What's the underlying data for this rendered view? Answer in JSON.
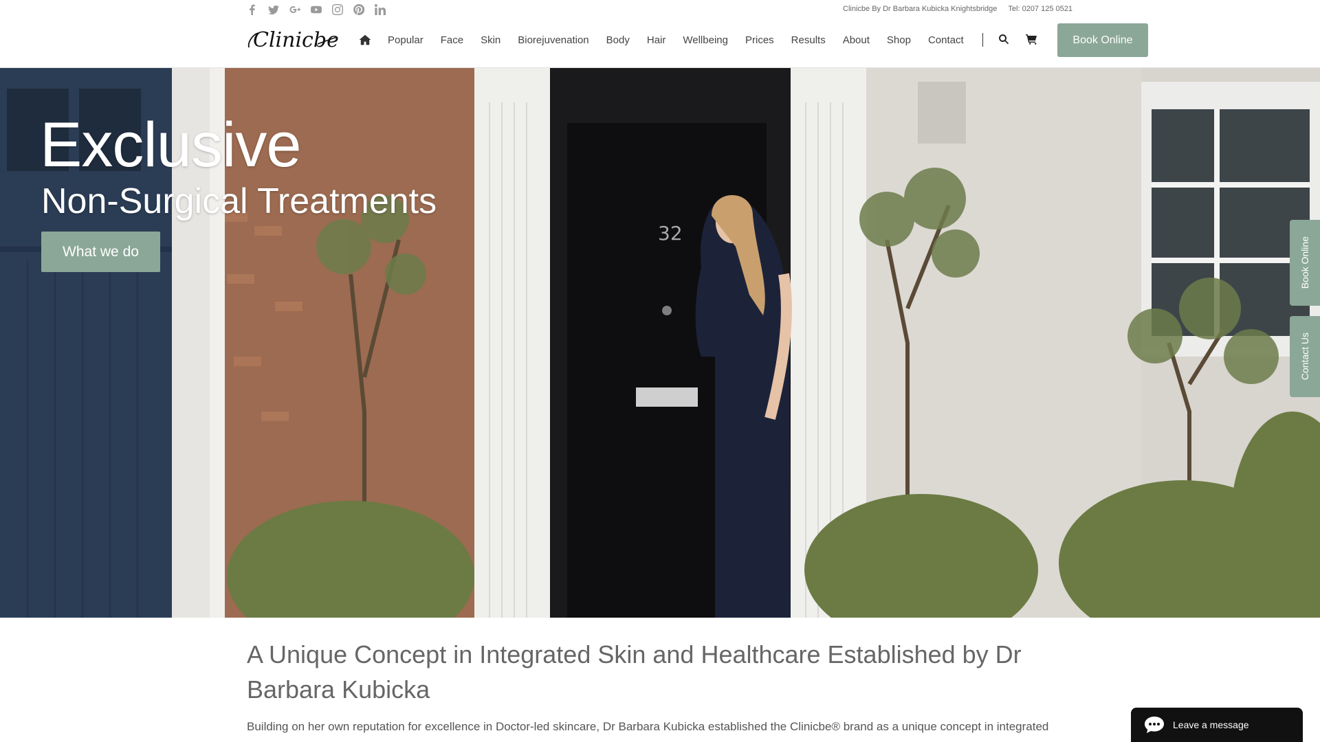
{
  "topbar": {
    "social": [
      {
        "icon": "facebook-icon"
      },
      {
        "icon": "twitter-icon"
      },
      {
        "icon": "google-plus-icon"
      },
      {
        "icon": "youtube-icon"
      },
      {
        "icon": "instagram-icon"
      },
      {
        "icon": "pinterest-icon"
      },
      {
        "icon": "linkedin-icon"
      }
    ],
    "clinic_name": "Clinicbe By Dr Barbara Kubicka Knightsbridge",
    "phone": "Tel: 0207 125 0521"
  },
  "header": {
    "logo_text": "Clinicbe",
    "nav": [
      "Popular",
      "Face",
      "Skin",
      "Biorejuvenation",
      "Body",
      "Hair",
      "Wellbeing",
      "Prices",
      "Results",
      "About",
      "Shop",
      "Contact"
    ],
    "book_label": "Book Online"
  },
  "hero": {
    "title": "Exclusive",
    "subtitle": "Non-Surgical Treatments",
    "button": "What we do",
    "door_number": "32"
  },
  "side_tabs": {
    "book": "Book Online",
    "contact": "Contact Us"
  },
  "content": {
    "heading": "A Unique Concept in Integrated Skin and Healthcare Established by Dr Barbara Kubicka",
    "paragraph": "Building on her own reputation for excellence in Doctor-led skincare, Dr Barbara Kubicka established the Clinicbe® brand as a unique concept in integrated"
  },
  "chat": {
    "label": "Leave a message"
  },
  "colors": {
    "accent": "#8ba797",
    "chat_bg": "#111111"
  }
}
